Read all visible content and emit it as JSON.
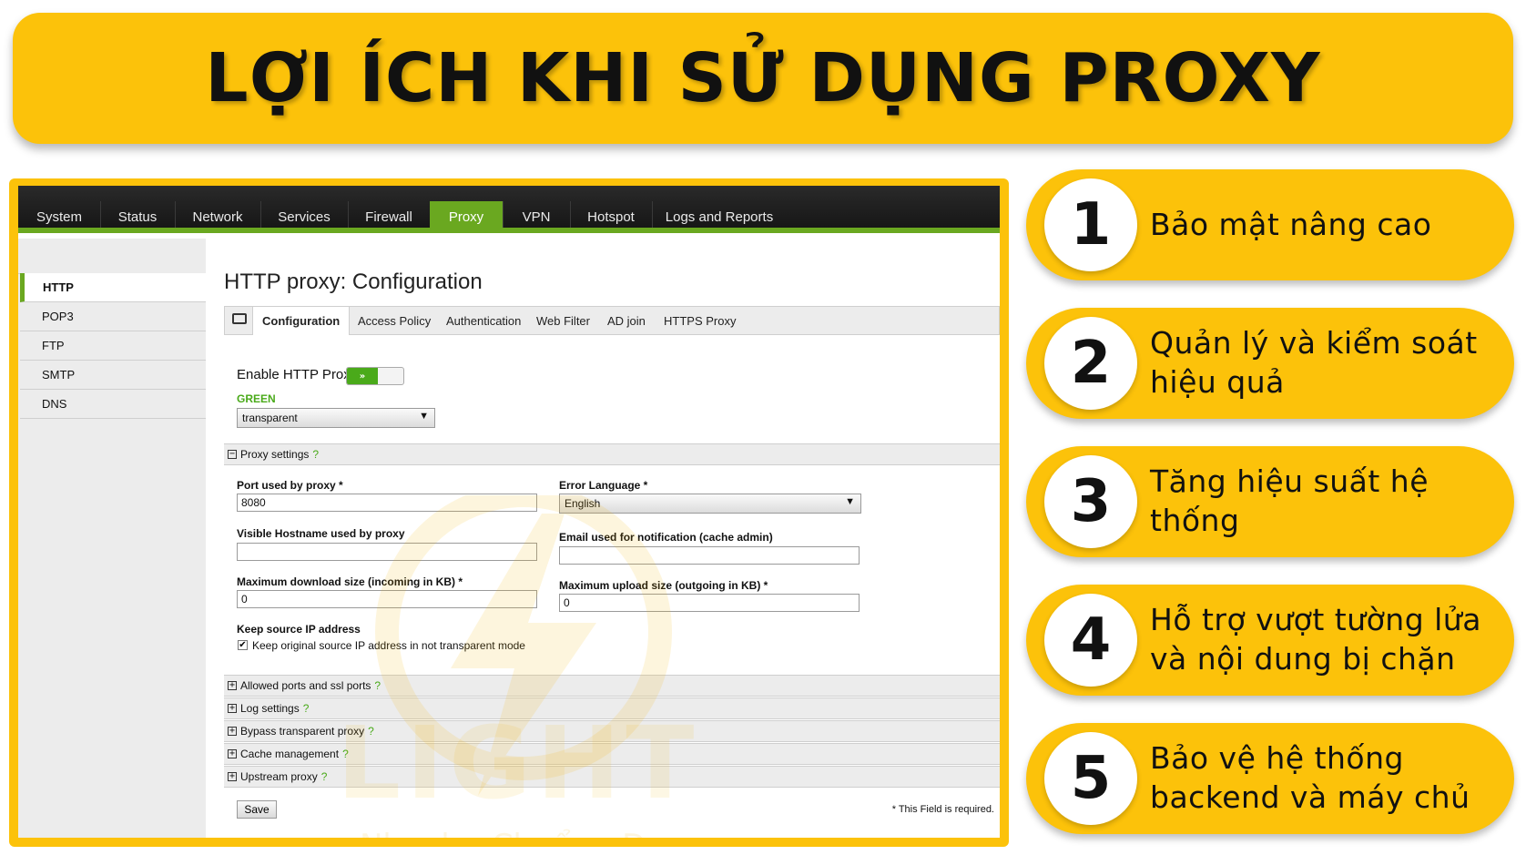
{
  "title": "LỢI ÍCH KHI SỬ DỤNG PROXY",
  "colors": {
    "brand_yellow": "#fcc20a",
    "nav_green": "#6aa820",
    "dark_nav": "#1c1c1c"
  },
  "nav": {
    "items": [
      "System",
      "Status",
      "Network",
      "Services",
      "Firewall",
      "Proxy",
      "VPN",
      "Hotspot",
      "Logs and Reports"
    ],
    "active": "Proxy"
  },
  "left_menu": {
    "items": [
      "HTTP",
      "POP3",
      "FTP",
      "SMTP",
      "DNS"
    ],
    "active": "HTTP"
  },
  "page_title": "HTTP proxy: Configuration",
  "tabs": {
    "items": [
      "Configuration",
      "Access Policy",
      "Authentication",
      "Web Filter",
      "AD join",
      "HTTPS Proxy"
    ],
    "active": "Configuration",
    "folder_icon": "folder-icon"
  },
  "form": {
    "enable_label": "Enable HTTP Proxy",
    "toggle_text": "»",
    "zone_label": "GREEN",
    "mode_value": "transparent",
    "proxy_settings_label": "Proxy settings",
    "port_label": "Port used by proxy *",
    "port_value": "8080",
    "error_lang_label": "Error Language *",
    "error_lang_value": "English",
    "hostname_label": "Visible Hostname used by proxy",
    "hostname_value": "",
    "email_label": "Email used for notification (cache admin)",
    "email_value": "",
    "max_download_label": "Maximum download size (incoming in KB) *",
    "max_download_value": "0",
    "max_upload_label": "Maximum upload size (outgoing in KB) *",
    "max_upload_value": "0",
    "keep_ip_label": "Keep source IP address",
    "keep_ip_checkbox_label": "Keep original source IP address in not transparent mode",
    "keep_ip_checked": true
  },
  "sections": [
    "Allowed ports and ssl ports",
    "Log settings",
    "Bypass transparent proxy",
    "Cache management",
    "Upstream proxy"
  ],
  "help_mark": "?",
  "save_label": "Save",
  "required_note": "* This Field is required.",
  "watermark": {
    "brand": "LIGHT",
    "slogan": "Nhanh - Chuẩn - Đẹp"
  },
  "benefits": [
    {
      "num": "1",
      "text": "Bảo mật nâng cao"
    },
    {
      "num": "2",
      "text": "Quản lý và kiểm soát hiệu quả"
    },
    {
      "num": "3",
      "text": "Tăng hiệu suất hệ thống"
    },
    {
      "num": "4",
      "text": "Hỗ trợ vượt tường lửa và nội dung bị chặn"
    },
    {
      "num": "5",
      "text": "Bảo vệ hệ thống backend và máy chủ"
    }
  ]
}
